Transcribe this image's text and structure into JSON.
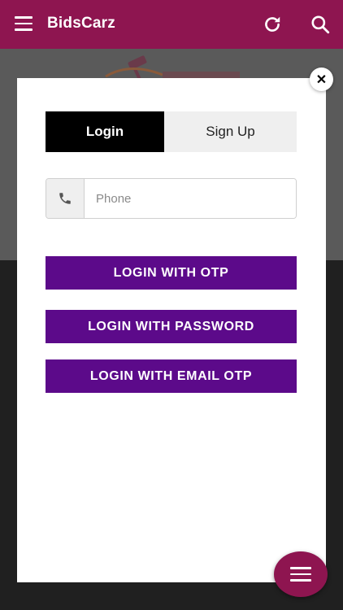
{
  "appbar": {
    "title": "BidsCarz",
    "menu_icon": "hamburger-menu-icon",
    "refresh_icon": "refresh-icon",
    "search_icon": "search-icon"
  },
  "modal": {
    "close_label": "✕",
    "tabs": [
      {
        "label": "Login",
        "active": true
      },
      {
        "label": "Sign Up",
        "active": false
      }
    ],
    "phone": {
      "placeholder": "Phone",
      "icon": "phone-icon"
    },
    "buttons": {
      "otp": "LOGIN WITH OTP",
      "password": "LOGIN WITH PASSWORD",
      "email_otp": "LOGIN WITH EMAIL OTP"
    }
  },
  "colors": {
    "brand": "#8e1550",
    "action": "#5c0a8a"
  }
}
